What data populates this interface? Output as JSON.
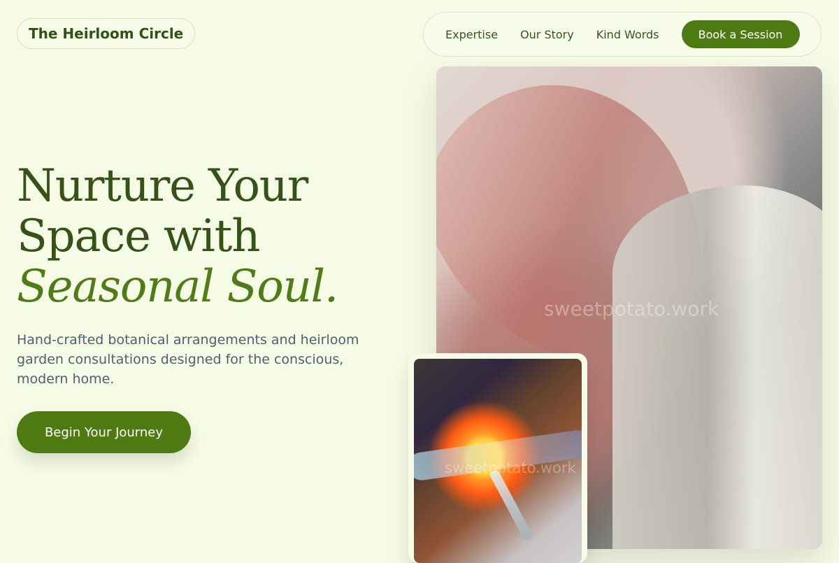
{
  "brand": {
    "name": "The Heirloom Circle"
  },
  "nav": {
    "items": [
      {
        "label": "Expertise"
      },
      {
        "label": "Our Story"
      },
      {
        "label": "Kind Words"
      }
    ],
    "cta_label": "Book a Session"
  },
  "hero": {
    "headline_line1": "Nurture Your",
    "headline_line2": "Space with",
    "headline_accent": "Seasonal Soul.",
    "description": "Hand-crafted botanical arrangements and heirloom garden consultations designed for the conscious, modern home.",
    "cta_label": "Begin Your Journey"
  },
  "images": {
    "primary_watermark": "sweetpotato.work",
    "secondary_watermark": "sweetpotato.work"
  },
  "colors": {
    "page_background": "#f6fbe5",
    "brand_green": "#4e7a14",
    "heading_green": "#355319",
    "body_text": "#4f5f71"
  }
}
